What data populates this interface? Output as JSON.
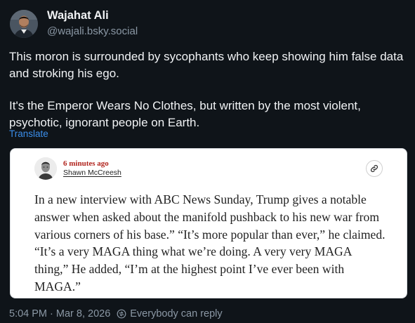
{
  "author": {
    "display_name": "Wajahat Ali",
    "handle": "@wajali.bsky.social"
  },
  "post": {
    "paragraphs": [
      "This moron is surrounded by sycophants who keep showing him false data and stroking his ego.",
      "It's the Emperor Wears No Clothes, but written by the most violent, psychotic, ignorant people on Earth."
    ],
    "translate_label": "Translate"
  },
  "quote": {
    "time_ago": "6 minutes ago",
    "author_name": "Shawn McCreesh",
    "text": "In a new interview with ABC News Sunday, Trump gives a notable answer when asked about the manifold pushback to his new war from various corners of his base.” “It’s more popular than ever,” he claimed. “It’s a very MAGA thing what we’re doing. A very very MAGA thing,” He added, “I’m at the highest point I’ve ever been with MAGA.”",
    "link_icon": "link-icon"
  },
  "meta": {
    "timestamp": "5:04 PM · Mar 8, 2026",
    "reply_setting": "Everybody can reply",
    "reply_icon": "reply-setting-icon"
  },
  "colors": {
    "background": "#0f1419",
    "accent": "#3b8eea",
    "timeago_red": "#b1241d"
  }
}
